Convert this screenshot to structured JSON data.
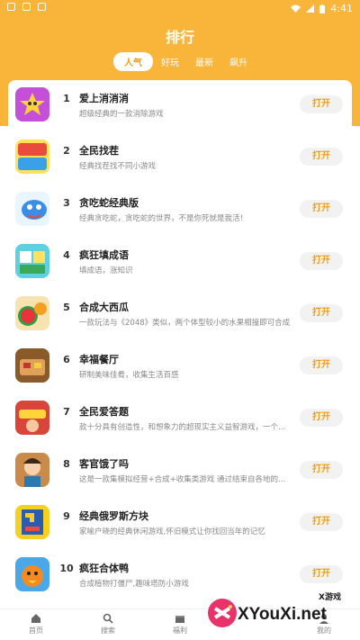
{
  "status_bar": {
    "time": "4:41"
  },
  "header": {
    "title": "排行"
  },
  "tabs": [
    {
      "label": "人气",
      "active": true
    },
    {
      "label": "好玩",
      "active": false
    },
    {
      "label": "最新",
      "active": false
    },
    {
      "label": "飙升",
      "active": false
    }
  ],
  "open_label": "打开",
  "games": [
    {
      "rank": "1",
      "name": "爱上消消消",
      "desc": "超级经典的一款消除游戏"
    },
    {
      "rank": "2",
      "name": "全民找茬",
      "desc": "经典找茬找不同小游戏"
    },
    {
      "rank": "3",
      "name": "贪吃蛇经典版",
      "desc": "经典贪吃蛇，贪吃蛇的世界，不是你死就是我活！"
    },
    {
      "rank": "4",
      "name": "疯狂填成语",
      "desc": "填成语，涨知识"
    },
    {
      "rank": "5",
      "name": "合成大西瓜",
      "desc": "一款玩法与《2048》类似，两个体型较小的水果相撞即可合成"
    },
    {
      "rank": "6",
      "name": "幸福餐厅",
      "desc": "研制美味佳肴，收集生活百感"
    },
    {
      "rank": "7",
      "name": "全民爱答题",
      "desc": "款十分具有创造性，和想象力的超现实主义益智游戏，一个..."
    },
    {
      "rank": "8",
      "name": "客官饿了吗",
      "desc": "这是一款集模拟经营+合成+收集类游戏 通过结束自各地的..."
    },
    {
      "rank": "9",
      "name": "经典俄罗斯方块",
      "desc": "家喻户晓的经典休闲游戏,怀旧模式让你找回当年的记忆"
    },
    {
      "rank": "10",
      "name": "疯狂合体鸭",
      "desc": "合成植物打僵尸,趣味塔防小游戏"
    }
  ],
  "bottom_nav": [
    {
      "label": "首页",
      "icon": "home-icon"
    },
    {
      "label": "搜索",
      "icon": "search-icon"
    },
    {
      "label": "福利",
      "icon": "gift-icon"
    },
    {
      "label": "我的",
      "icon": "user-icon"
    }
  ],
  "watermark": {
    "text": "XYouXi.net",
    "small": "X游戏"
  },
  "colors": {
    "accent": "#f9b43a",
    "button_text": "#f39c12"
  }
}
